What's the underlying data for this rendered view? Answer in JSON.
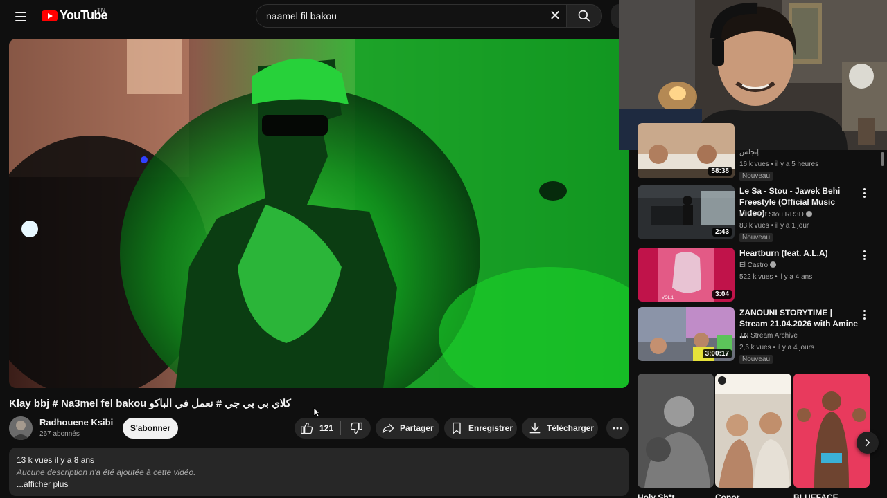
{
  "header": {
    "logo_text": "YouTube",
    "country": "TN",
    "search_value": "naamel fil bakou",
    "clear_symbol": "✕"
  },
  "video": {
    "title": "Klay bbj # Na3mel fel bakou كلاي بي بي جي # نعمل في الباكو",
    "channel_name": "Radhouene Ksibi",
    "subscribers": "267 abonnés",
    "subscribe_label": "S'abonner",
    "likes": "121",
    "share_label": "Partager",
    "save_label": "Enregistrer",
    "download_label": "Télécharger"
  },
  "description": {
    "meta": "13 k vues  il y a 8 ans",
    "text": "Aucune description n'a été ajoutée à cette vidéo.",
    "more": "...afficher plus"
  },
  "sidebar": {
    "items": [
      {
        "title": "",
        "channel": "إنجلس",
        "stats": "16 k vues • il y a 5 heures",
        "badge": "Nouveau",
        "duration": "58:38"
      },
      {
        "title": "Le Sa - Stou - Jawek Behi Freestyle (Official Music Video)",
        "channel": "LE-SA et Stou RR3D",
        "stats": "83 k vues • il y a 1 jour",
        "badge": "Nouveau",
        "duration": "2:43"
      },
      {
        "title": "Heartburn (feat. A.L.A)",
        "channel": "El Castro",
        "stats": "522 k vues • il y a 4 ans",
        "badge": "",
        "duration": "3:04",
        "thumb_text": "VOL.1"
      },
      {
        "title": "ZANOUNI STORYTIME | Stream 21.04.2026 with Amine ...",
        "channel": "TN Stream Archive",
        "stats": "2,6 k vues • il y a 4 jours",
        "badge": "Nouveau",
        "duration": "3:00:17"
      }
    ]
  },
  "shorts": [
    {
      "label": "Holy Sh*t"
    },
    {
      "label": "Conor ..."
    },
    {
      "label": "BLUEFACE ..."
    }
  ],
  "icons": {
    "menu": "menu-icon",
    "search": "search-icon",
    "like": "thumbs-up-icon",
    "dislike": "thumbs-down-icon",
    "share": "share-icon",
    "save": "bookmark-icon",
    "download": "download-icon",
    "more": "more-horizontal-icon",
    "next": "chevron-right-icon"
  },
  "colors": {
    "background": "#0f0f0f",
    "logo_red": "#ff0000",
    "pill_bg": "#272727",
    "video_green": "#1fdc2a"
  }
}
